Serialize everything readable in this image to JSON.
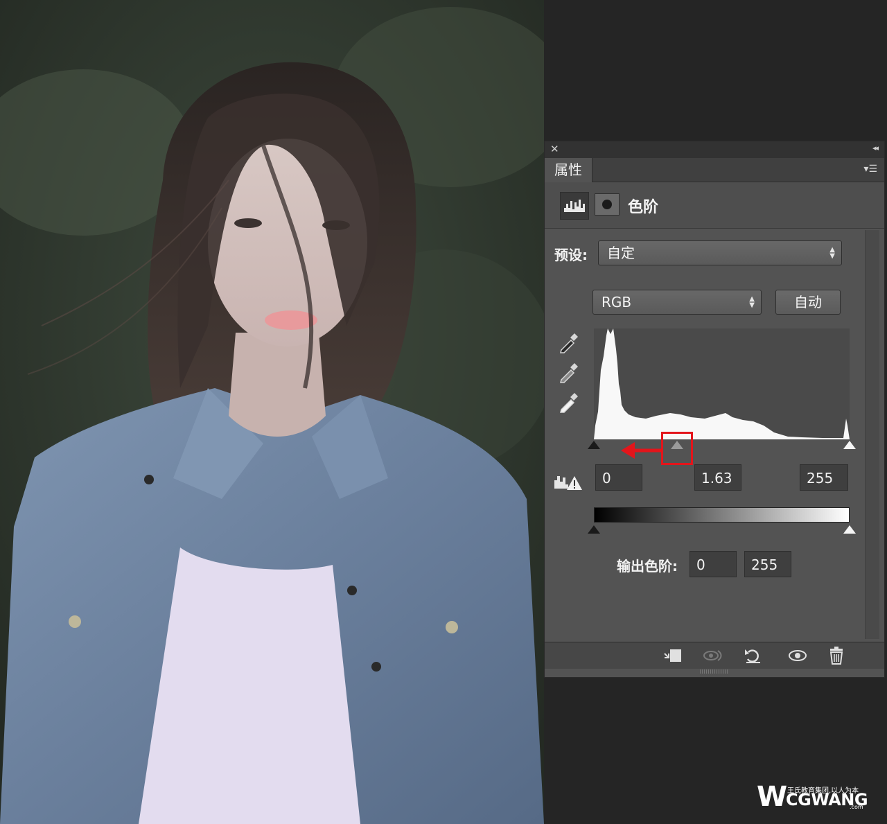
{
  "panel": {
    "tab_label": "属性",
    "adjustment_type": "色阶",
    "preset_label": "预设:",
    "preset_value": "自定",
    "channel_value": "RGB",
    "auto_button": "自动",
    "input_levels": {
      "black": "0",
      "midtone": "1.63",
      "white": "255"
    },
    "output_label": "输出色阶:",
    "output_levels": {
      "black": "0",
      "white": "255"
    }
  },
  "watermark": {
    "name": "CGWANG",
    "tagline": "王氏教育集团,以人为本",
    "suffix": ".com"
  }
}
